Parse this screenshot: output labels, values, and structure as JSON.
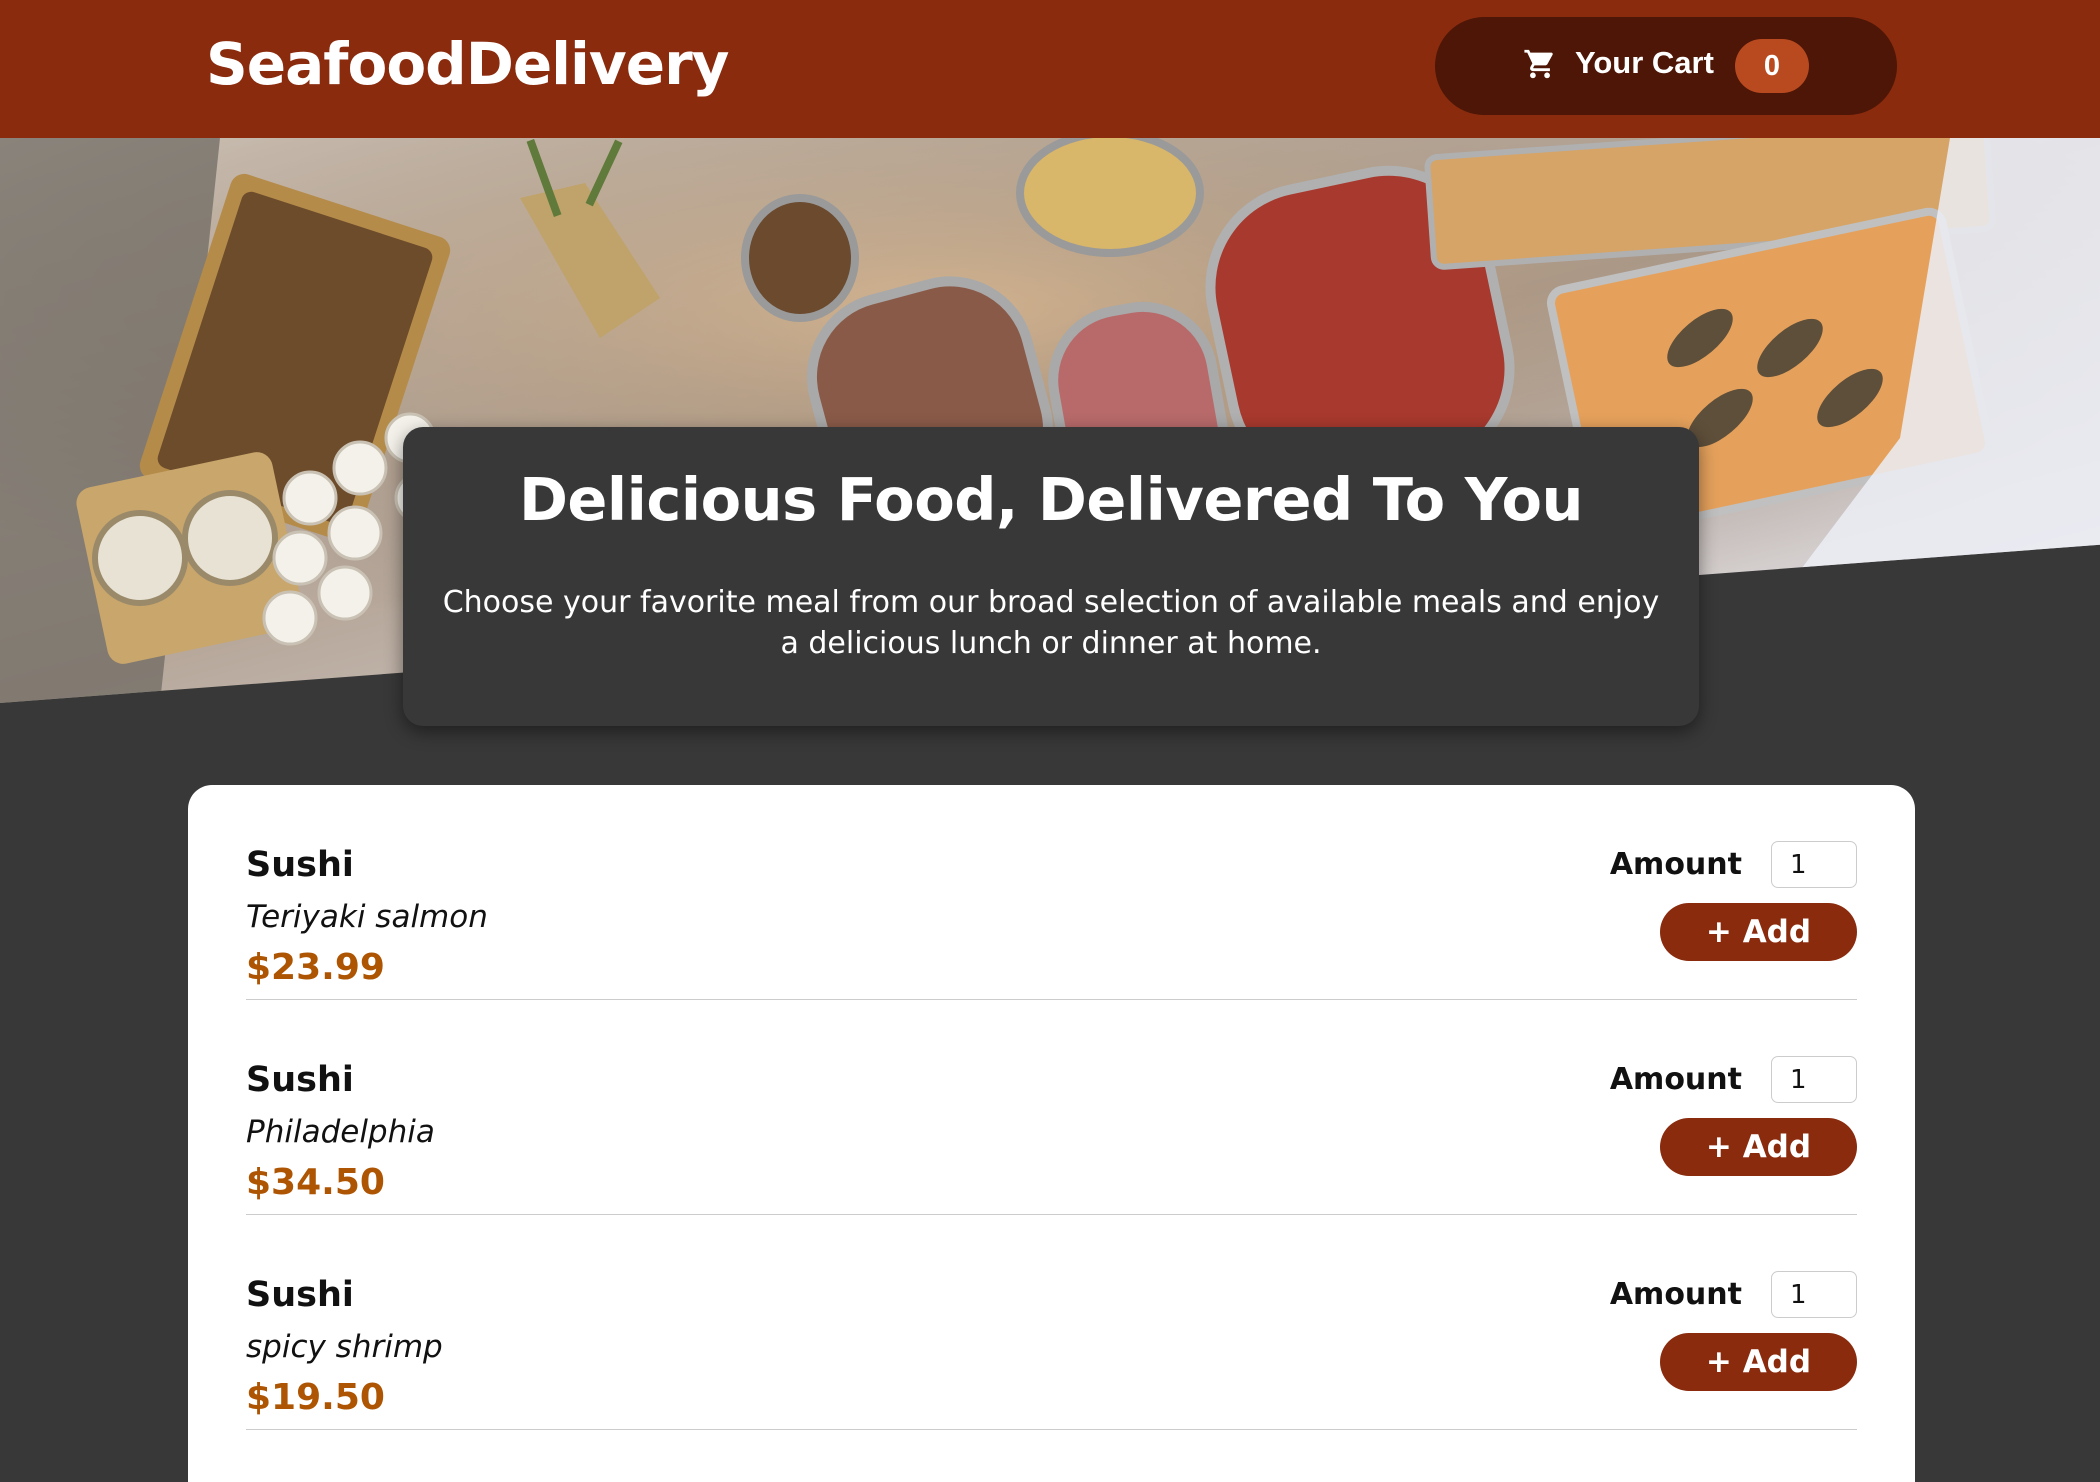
{
  "header": {
    "brand": "SeafoodDelivery",
    "cart": {
      "icon": "cart-icon",
      "label": "Your Cart",
      "count": "0"
    }
  },
  "intro": {
    "title": "Delicious Food, Delivered To You",
    "text": "Choose your favorite meal from our broad selection of available meals and enjoy a delicious lunch or dinner at home."
  },
  "meals": [
    {
      "name": "Sushi",
      "description": "Teriyaki salmon",
      "price": "$23.99",
      "amount_label": "Amount",
      "amount": "1",
      "add_label": "+ Add"
    },
    {
      "name": "Sushi",
      "description": "Philadelphia",
      "price": "$34.50",
      "amount_label": "Amount",
      "amount": "1",
      "add_label": "+ Add"
    },
    {
      "name": "Sushi",
      "description": "spicy shrimp",
      "price": "$19.50",
      "amount_label": "Amount",
      "amount": "1",
      "add_label": "+ Add"
    }
  ],
  "colors": {
    "header": "#8a2b0e",
    "cart_button": "#4d1606",
    "badge": "#b94a20",
    "background": "#383838",
    "price": "#ad5502",
    "add_button": "#8a2b0e"
  }
}
